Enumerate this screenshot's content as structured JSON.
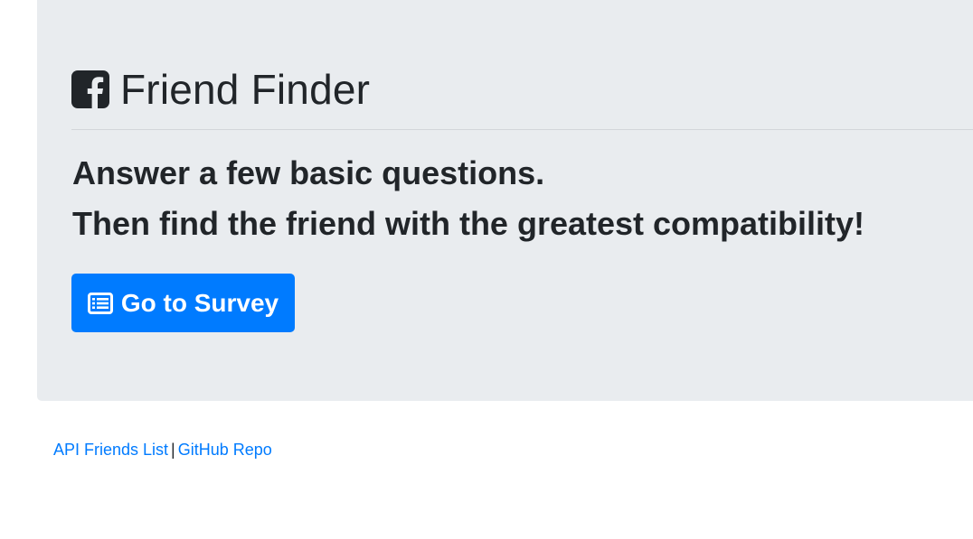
{
  "header": {
    "title": "Friend Finder",
    "icon": "facebook-square-icon"
  },
  "lead": {
    "line1": "Answer a few basic questions.",
    "line2": "Then find the friend with the greatest compatibility!"
  },
  "survey_button": {
    "label": "Go to Survey",
    "icon": "list-alt-icon"
  },
  "footer": {
    "api_link": "API Friends List",
    "separator": "|",
    "repo_link": "GitHub Repo"
  },
  "colors": {
    "jumbotron_bg": "#e9ecef",
    "primary": "#007bff",
    "text": "#212529"
  }
}
